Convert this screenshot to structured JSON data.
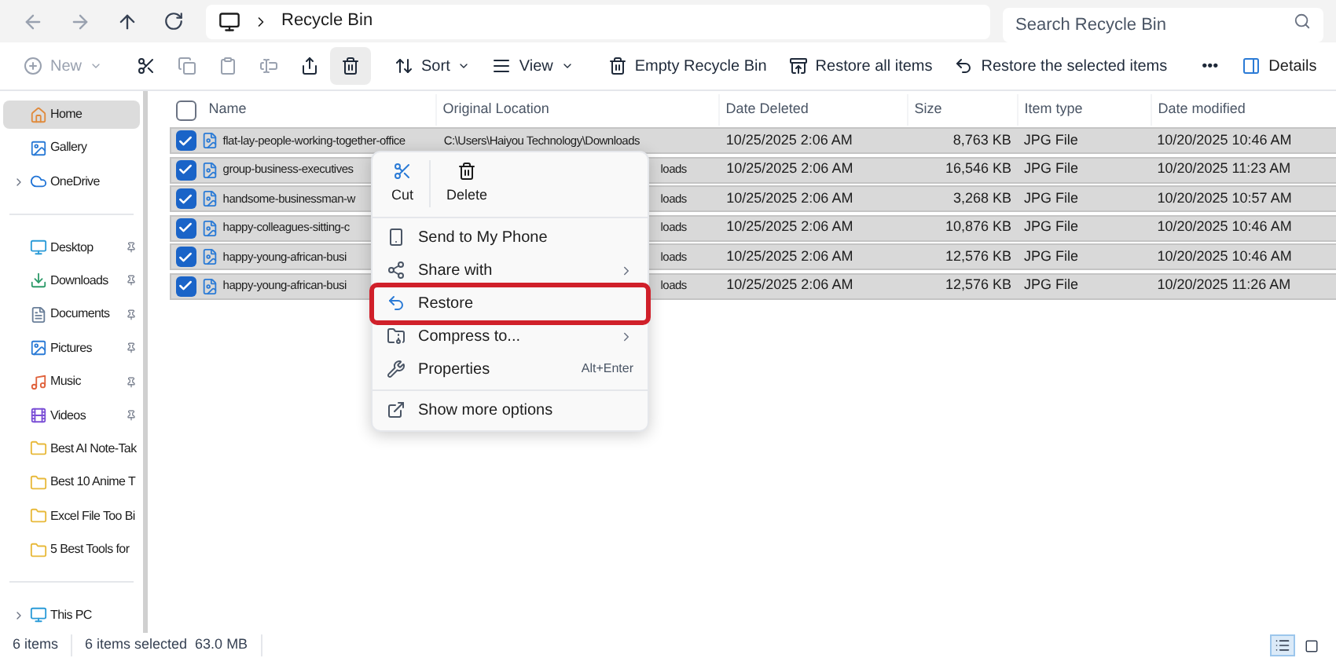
{
  "address": {
    "crumbs": [
      "Recycle Bin"
    ]
  },
  "search": {
    "placeholder": "Search Recycle Bin"
  },
  "toolbar": {
    "items": [
      {
        "kind": "new",
        "label": "New",
        "disabled": true
      },
      {
        "kind": "cut",
        "disabled": false
      },
      {
        "kind": "copy",
        "disabled": true
      },
      {
        "kind": "paste",
        "disabled": true
      },
      {
        "kind": "rename",
        "disabled": true
      },
      {
        "kind": "share",
        "disabled": false
      },
      {
        "kind": "delete",
        "disabled": false
      },
      {
        "kind": "sort",
        "label": "Sort",
        "disabled": false
      },
      {
        "kind": "view",
        "label": "View",
        "disabled": false
      },
      {
        "kind": "empty",
        "label": "Empty Recycle Bin",
        "disabled": false
      },
      {
        "kind": "restore_all",
        "label": "Restore all items",
        "disabled": false
      },
      {
        "kind": "restore_selected",
        "label": "Restore the selected items",
        "disabled": false
      },
      {
        "kind": "more",
        "label": "•••",
        "disabled": false
      }
    ],
    "details": "Details"
  },
  "sidebar": {
    "items": [
      {
        "kind": "home",
        "label": "Home",
        "selected": true,
        "pinned": false,
        "expandable": false
      },
      {
        "kind": "gallery",
        "label": "Gallery",
        "selected": false,
        "pinned": false,
        "expandable": false
      },
      {
        "kind": "onedrive",
        "label": "OneDrive",
        "selected": false,
        "pinned": false,
        "expandable": true
      },
      {
        "kind": "divider"
      },
      {
        "kind": "desktop",
        "label": "Desktop",
        "selected": false,
        "pinned": true,
        "expandable": false
      },
      {
        "kind": "downloads",
        "label": "Downloads",
        "selected": false,
        "pinned": true,
        "expandable": false
      },
      {
        "kind": "documents",
        "label": "Documents",
        "selected": false,
        "pinned": true,
        "expandable": false
      },
      {
        "kind": "pictures",
        "label": "Pictures",
        "selected": false,
        "pinned": true,
        "expandable": false
      },
      {
        "kind": "music",
        "label": "Music",
        "selected": false,
        "pinned": true,
        "expandable": false
      },
      {
        "kind": "videos",
        "label": "Videos",
        "selected": false,
        "pinned": true,
        "expandable": false
      },
      {
        "kind": "folder",
        "label": "Best AI Note-Tak",
        "selected": false,
        "pinned": false,
        "expandable": false
      },
      {
        "kind": "folder",
        "label": "Best 10 Anime T",
        "selected": false,
        "pinned": false,
        "expandable": false
      },
      {
        "kind": "folder",
        "label": "Excel File Too Bi",
        "selected": false,
        "pinned": false,
        "expandable": false
      },
      {
        "kind": "folder",
        "label": "5 Best Tools for",
        "selected": false,
        "pinned": false,
        "expandable": false
      },
      {
        "kind": "divider"
      },
      {
        "kind": "pc",
        "label": "This PC",
        "selected": false,
        "pinned": false,
        "expandable": true
      }
    ]
  },
  "table": {
    "columns": [
      "Name",
      "Original Location",
      "Date Deleted",
      "Size",
      "Item type",
      "Date modified"
    ],
    "all_checked": false,
    "rows": [
      {
        "name": "flat-lay-people-working-together-office",
        "location": "C:\\Users\\Haiyou Technology\\Downloads",
        "location_hidden": false,
        "date_deleted": "10/25/2025 2:06 AM",
        "size": "8,763 KB",
        "type": "JPG File",
        "date_modified": "10/20/2025 10:46 AM",
        "selected": true
      },
      {
        "name": "group-business-executives",
        "location": "loads",
        "location_hidden": true,
        "date_deleted": "10/25/2025 2:06 AM",
        "size": "16,546 KB",
        "type": "JPG File",
        "date_modified": "10/20/2025 11:23 AM",
        "selected": true
      },
      {
        "name": "handsome-businessman-w",
        "location": "loads",
        "location_hidden": true,
        "date_deleted": "10/25/2025 2:06 AM",
        "size": "3,268 KB",
        "type": "JPG File",
        "date_modified": "10/20/2025 10:57 AM",
        "selected": true
      },
      {
        "name": "happy-colleagues-sitting-c",
        "location": "loads",
        "location_hidden": true,
        "date_deleted": "10/25/2025 2:06 AM",
        "size": "10,876 KB",
        "type": "JPG File",
        "date_modified": "10/20/2025 10:46 AM",
        "selected": true
      },
      {
        "name": "happy-young-african-busi",
        "location": "loads",
        "location_hidden": true,
        "date_deleted": "10/25/2025 2:06 AM",
        "size": "12,576 KB",
        "type": "JPG File",
        "date_modified": "10/20/2025 10:46 AM",
        "selected": true
      },
      {
        "name": "happy-young-african-busi",
        "location": "loads",
        "location_hidden": true,
        "date_deleted": "10/25/2025 2:06 AM",
        "size": "12,576 KB",
        "type": "JPG File",
        "date_modified": "10/20/2025 11:26 AM",
        "selected": true
      }
    ]
  },
  "context_menu": {
    "top": [
      {
        "kind": "cut",
        "label": "Cut"
      },
      {
        "kind": "delete",
        "label": "Delete"
      }
    ],
    "items": [
      {
        "kind": "phone",
        "label": "Send to My Phone",
        "submenu": false,
        "highlighted": false
      },
      {
        "kind": "share",
        "label": "Share with",
        "submenu": true,
        "highlighted": false
      },
      {
        "kind": "restore",
        "label": "Restore",
        "submenu": false,
        "highlighted": true
      },
      {
        "kind": "compress",
        "label": "Compress to...",
        "submenu": true,
        "highlighted": false
      },
      {
        "kind": "properties",
        "label": "Properties",
        "shortcut": "Alt+Enter",
        "submenu": false,
        "highlighted": false
      },
      {
        "kind": "divider"
      },
      {
        "kind": "more",
        "label": "Show more options",
        "submenu": false,
        "highlighted": false
      }
    ]
  },
  "status_bar": {
    "count": "6 items",
    "selection": "6 items selected  63.0 MB",
    "view_buttons": [
      {
        "kind": "details",
        "selected": true
      },
      {
        "kind": "tiles",
        "selected": false
      }
    ]
  }
}
